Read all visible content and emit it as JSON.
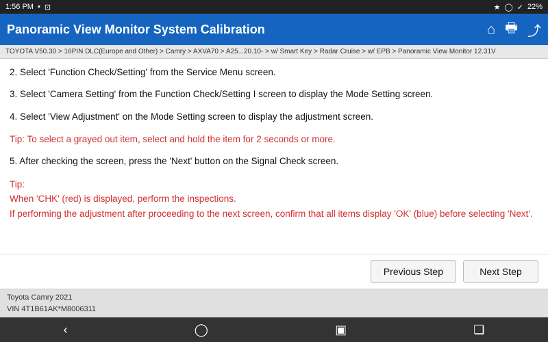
{
  "statusBar": {
    "time": "1:56 PM",
    "battery": "22%",
    "icons": [
      "bluetooth",
      "battery-alert",
      "brightness",
      "check-circle"
    ]
  },
  "titleBar": {
    "title": "Panoramic View Monitor System Calibration",
    "icons": [
      "home",
      "print",
      "export"
    ]
  },
  "breadcrumb": "TOYOTA V50.30 > 16PIN DLC(Europe and Other) > Camry > AXVA70 > A25...20.10- > w/ Smart Key > Radar Cruise > w/ EPB > Panoramic View Monitor   12.31V",
  "instructions": [
    {
      "id": "step2",
      "text": "2. Select 'Function Check/Setting' from the Service Menu screen."
    },
    {
      "id": "step3",
      "text": "3. Select 'Camera Setting' from the Function Check/Setting I screen to display the Mode Setting screen."
    },
    {
      "id": "step4",
      "text": "4. Select 'View Adjustment' on the Mode Setting screen to display the adjustment screen."
    },
    {
      "id": "tip4",
      "text": "Tip: To select a grayed out item, select and hold the item for 2 seconds or more.",
      "isRed": true
    },
    {
      "id": "step5",
      "text": "5. After checking the screen, press the 'Next' button on the Signal Check screen."
    },
    {
      "id": "tip5",
      "text": "Tip:\nWhen 'CHK' (red) is displayed, perform the inspections.\nIf performing the adjustment after proceeding to the next screen, confirm that all items display 'OK' (blue) before selecting 'Next'.",
      "isRed": true
    }
  ],
  "buttons": {
    "previousStep": "Previous Step",
    "nextStep": "Next Step"
  },
  "footer": {
    "vehicle": "Toyota Camry 2021",
    "vin": "VIN 4T1B61AK*M8006311"
  },
  "navBar": {
    "icons": [
      "back",
      "circle",
      "square",
      "expand"
    ]
  }
}
